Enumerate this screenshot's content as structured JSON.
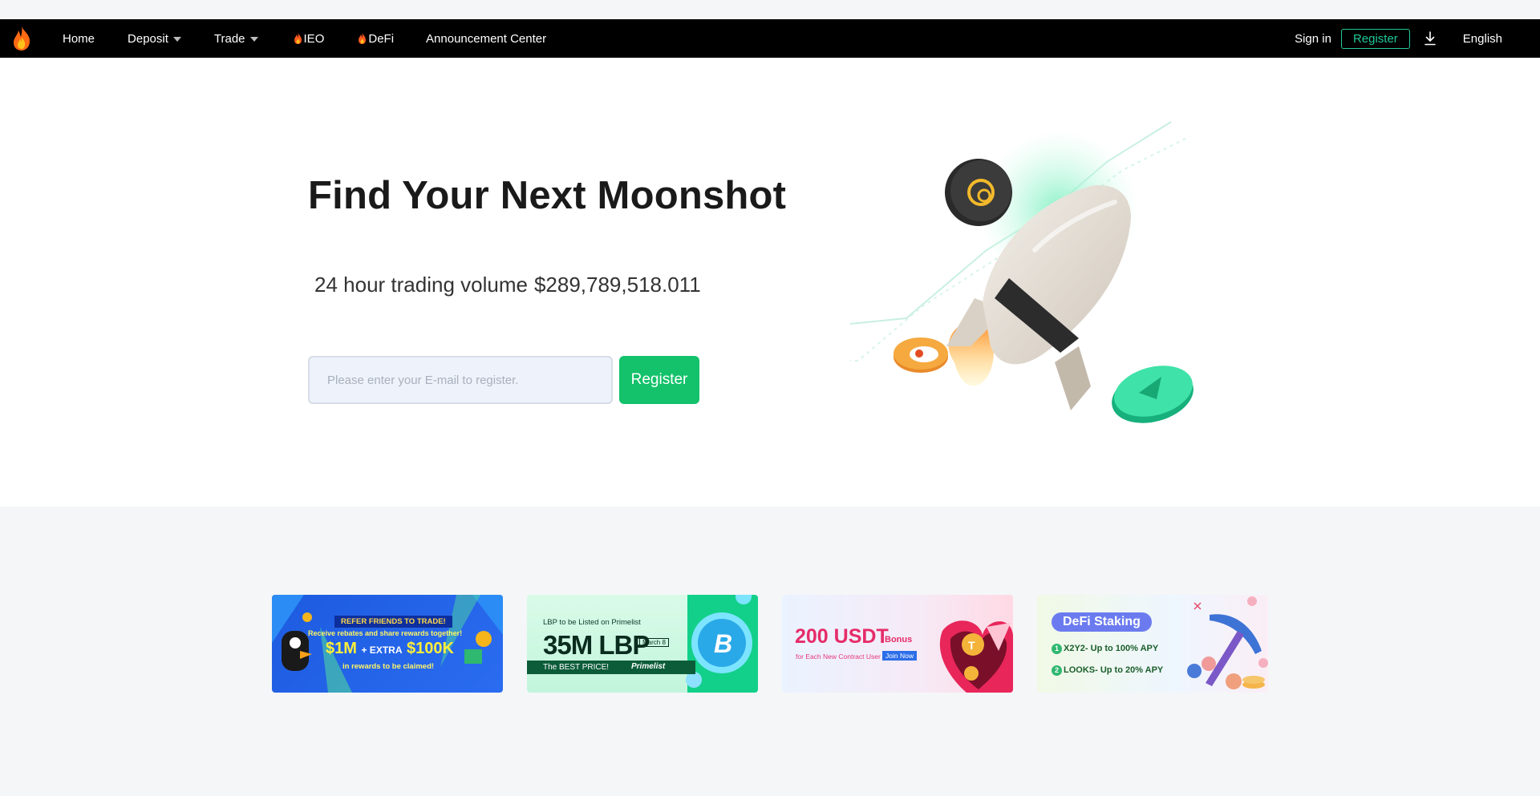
{
  "nav": {
    "items": [
      {
        "label": "Home",
        "has_caret": false,
        "has_fire": false
      },
      {
        "label": "Deposit",
        "has_caret": true,
        "has_fire": false
      },
      {
        "label": "Trade",
        "has_caret": true,
        "has_fire": false
      },
      {
        "label": "IEO",
        "has_caret": false,
        "has_fire": true
      },
      {
        "label": "DeFi",
        "has_caret": false,
        "has_fire": true
      },
      {
        "label": "Announcement Center",
        "has_caret": false,
        "has_fire": false
      }
    ],
    "sign_in": "Sign in",
    "register": "Register",
    "language": "English",
    "logo_icon": "flame-logo-icon",
    "download_icon": "download-icon"
  },
  "hero": {
    "title": "Find Your Next Moonshot",
    "volume_label": "24 hour trading volume",
    "volume_value": "$289,789,518.011",
    "email_placeholder": "Please enter your E-mail to register.",
    "register_button": "Register"
  },
  "banners": [
    {
      "name": "refer-friends",
      "line1": "REFER FRIENDS TO TRADE!",
      "line2": "Receive rebates and share rewards together!",
      "line3a": "$1M",
      "line3b": "+ EXTRA",
      "line3c": "$100K",
      "line4": "in rewards to be claimed!"
    },
    {
      "name": "lbp-primelist",
      "line1": "LBP to be Listed on Primelist",
      "line2": "35M LBP",
      "date": "March 8",
      "line3": "The BEST PRICE!",
      "brand": "Primelist"
    },
    {
      "name": "usdt-bonus",
      "line1": "200 USDT",
      "line1b": "Bonus",
      "line2": "for Each New Contract User",
      "cta": "Join Now"
    },
    {
      "name": "defi-staking",
      "title": "DeFi Staking",
      "item1": "X2Y2- Up to 100% APY",
      "item2": "LOOKS- Up to 20% APY"
    }
  ],
  "colors": {
    "nav_bg": "#000000",
    "accent": "#13c26b",
    "register_outline": "#20c997",
    "hero_bg": "#ffffff",
    "page_bg": "#f5f6f8"
  }
}
